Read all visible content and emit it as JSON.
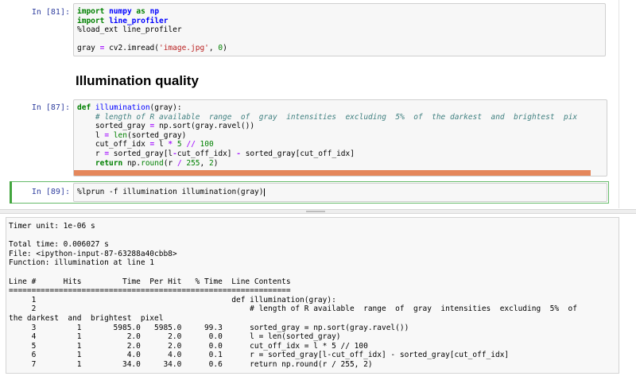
{
  "cells": [
    {
      "prompt": "In [81]:",
      "lines": [
        "import numpy as np",
        "import line_profiler",
        "%load_ext line_profiler",
        "",
        "gray = cv2.imread('image.jpg', 0)"
      ]
    },
    {
      "prompt": "In [87]:",
      "lines": [
        "def illumination(gray):",
        "    # length of R available  range  of  gray  intensities  excluding  5%  of  the darkest  and  brightest  pix",
        "    sorted_gray = np.sort(gray.ravel())",
        "    l = len(sorted_gray)",
        "    cut_off_idx = l * 5 // 100",
        "    r = sorted_gray[l-cut_off_idx] - sorted_gray[cut_off_idx]",
        "    return np.round(r / 255, 2)"
      ]
    },
    {
      "prompt": "In [89]:",
      "code": "%lprun -f illumination illumination(gray)"
    }
  ],
  "heading": "Illumination quality",
  "progress_fraction": 0.97,
  "pager": {
    "lines": [
      "Timer unit: 1e-06 s",
      "",
      "Total time: 0.006027 s",
      "File: <ipython-input-87-63288a40cbb8>",
      "Function: illumination at line 1",
      "",
      "Line #      Hits         Time  Per Hit   % Time  Line Contents",
      "==============================================================",
      "     1                                           def illumination(gray):",
      "     2                                               # length of R available  range  of  gray  intensities  excluding  5%  of",
      "the darkest  and  brightest  pixel",
      "     3         1       5985.0   5985.0     99.3      sorted_gray = np.sort(gray.ravel())",
      "     4         1          2.0      2.0      0.0      l = len(sorted_gray)",
      "     5         1          2.0      2.0      0.0      cut_off_idx = l * 5 // 100",
      "     6         1          4.0      4.0      0.1      r = sorted_gray[l-cut_off_idx] - sorted_gray[cut_off_idx]",
      "     7         1         34.0     34.0      0.6      return np.round(r / 255, 2)"
    ]
  },
  "colors": {
    "prompt": "#303f9f",
    "keyword": "#008000",
    "string": "#ba2121",
    "comment": "#408080",
    "progress": "#e5875b",
    "active_border": "#66bb6a"
  }
}
